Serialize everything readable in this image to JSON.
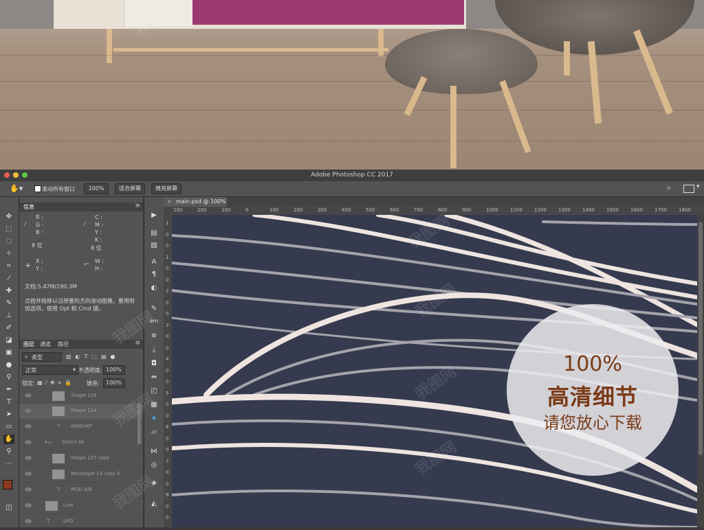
{
  "window": {
    "title": "Adobe Photoshop CC 2017"
  },
  "options_bar": {
    "scroll_all_label": "滚动所有窗口",
    "zoom_button": "100%",
    "fit_screen_button": "适合屏幕",
    "fill_screen_button": "填充屏幕"
  },
  "document": {
    "tab_title": "main.psd @ 100%"
  },
  "ruler": {
    "h_ticks": [
      "100",
      "200",
      "100",
      "0",
      "100",
      "200",
      "300",
      "400",
      "500",
      "600",
      "700",
      "800",
      "900",
      "1000",
      "1100",
      "1200",
      "1300",
      "1400",
      "1500",
      "1600",
      "1700",
      "1800"
    ],
    "v_ticks": [
      "1",
      "0",
      "0",
      "1",
      "0",
      "0",
      "2",
      "0",
      "0",
      "3",
      "0",
      "0",
      "4",
      "0",
      "0",
      "5",
      "0",
      "0",
      "6",
      "0",
      "0",
      "7",
      "0",
      "0",
      "8",
      "0",
      "0"
    ]
  },
  "info_panel": {
    "tab": "信息",
    "r": "R :",
    "g": "G :",
    "b": "B :",
    "c": "C :",
    "m": "M :",
    "y": "Y :",
    "k": "K :",
    "bits_left": "8 位",
    "bits_right": "8 位",
    "x": "X :",
    "y_coord": "Y :",
    "w": "W :",
    "h": "H :",
    "doc_size": "文档:5.47M/290.3M",
    "hint": "点按并拖移以沿想要的方向滚动图像。要用附加选项，使用 Opt 和 Cmd 键。"
  },
  "layers_panel": {
    "tabs": [
      "图层",
      "通道",
      "路径"
    ],
    "filter_label": "类型",
    "blend_mode": "正常",
    "opacity_label": "不透明度:",
    "opacity_value": "100%",
    "lock_label": "锁定:",
    "fill_label": "填充:",
    "fill_value": "100%",
    "layers": [
      {
        "name": "Shape 116"
      },
      {
        "name": "Shape 114"
      },
      {
        "name": "AMOUNT"
      },
      {
        "name": "Select All"
      },
      {
        "name": "Shape 107 copy"
      },
      {
        "name": "Rectangle 13 copy 5"
      },
      {
        "name": "MOD A/B"
      },
      {
        "name": "Line"
      },
      {
        "name": "UFO"
      }
    ]
  },
  "badge": {
    "line1": "100%",
    "line2": "高清细节",
    "line3": "请您放心下载"
  },
  "colors": {
    "canvas_bg": "#353a4e",
    "curve_light": "#efe4e0",
    "curve_gray": "#a5a3ab",
    "badge_text": "#7b3a16",
    "foreground_color": "#8a3b1f",
    "background_color": "#ffffff"
  }
}
